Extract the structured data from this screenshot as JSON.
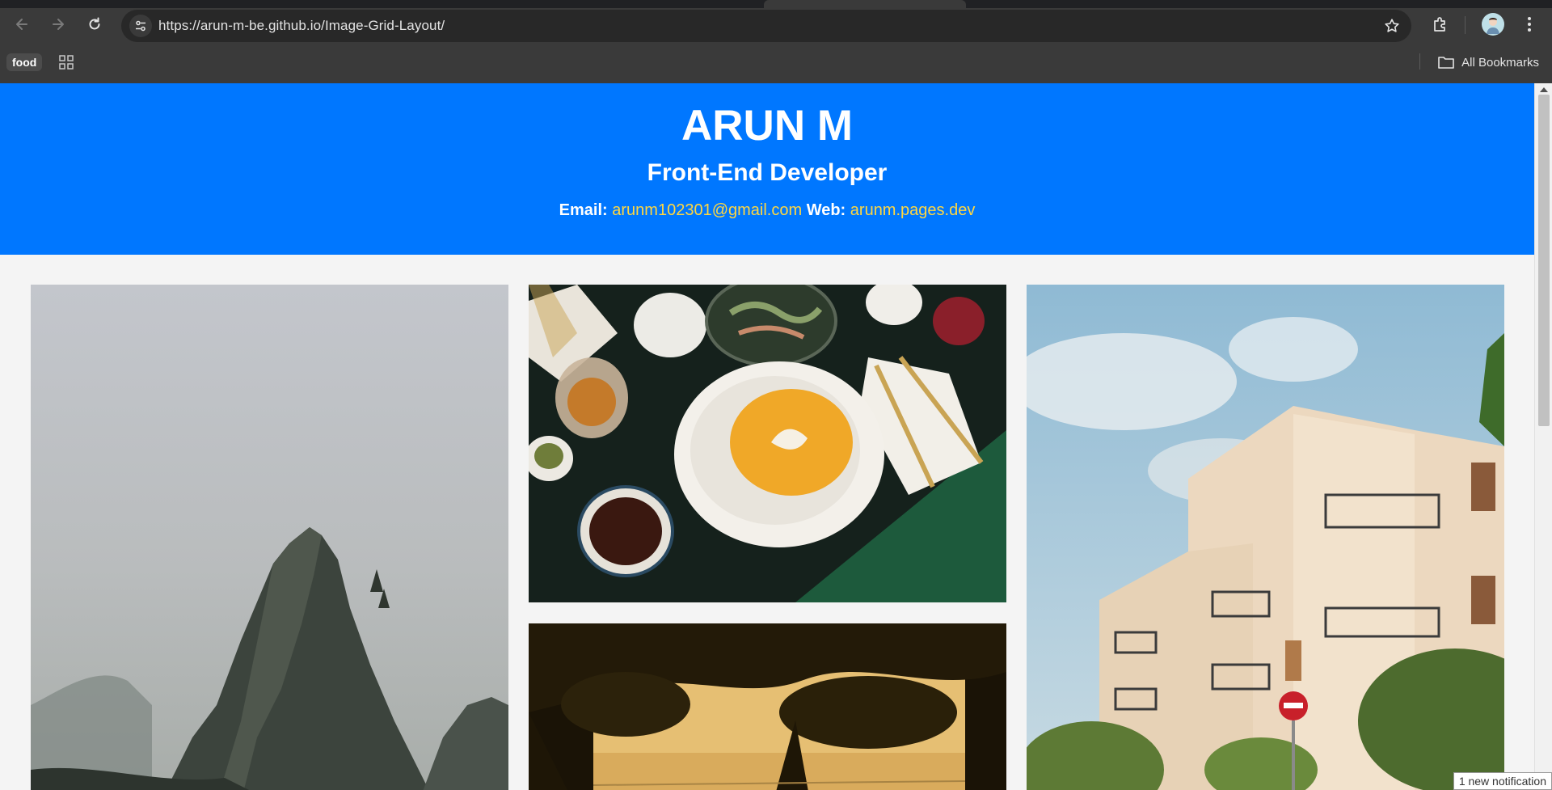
{
  "browser": {
    "url": "https://arun-m-be.github.io/Image-Grid-Layout/",
    "bookmarks": {
      "chip_label": "food",
      "all_bookmarks_label": "All Bookmarks"
    },
    "icons": [
      "back-icon",
      "forward-icon",
      "reload-icon",
      "site-info-icon",
      "star-icon",
      "extensions-icon",
      "profile-avatar",
      "menu-icon",
      "apps-grid-icon",
      "folder-icon"
    ]
  },
  "header": {
    "name": "ARUN M",
    "role": "Front-End Developer",
    "email_label": "Email:",
    "email": "arunm102301@gmail.com",
    "web_label": "Web:",
    "web": "arunm.pages.dev"
  },
  "gallery": {
    "images": [
      {
        "subject": "misty sea stack rock"
      },
      {
        "subject": "pumpkin soup table setting"
      },
      {
        "subject": "white apartment building"
      },
      {
        "subject": "sunlit tree foliage"
      }
    ]
  },
  "notification": "1 new notification",
  "colors": {
    "header_bg": "#0077ff",
    "link": "#ffd740",
    "page_bg": "#f4f4f4"
  }
}
